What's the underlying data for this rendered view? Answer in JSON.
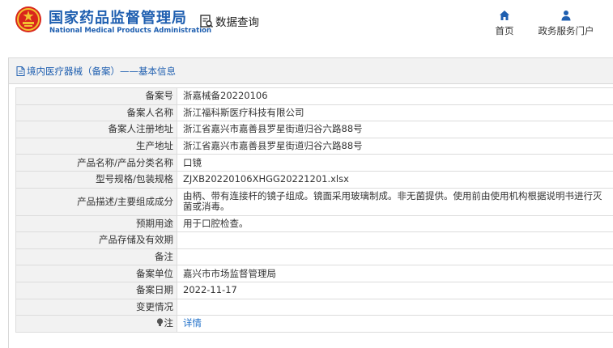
{
  "header": {
    "brand_cn": "国家药品监督管理局",
    "brand_en": "National Medical Products Administration",
    "query_label": "数据查询",
    "nav": {
      "home": "首页",
      "portal": "政务服务门户"
    }
  },
  "panel": {
    "title": "境内医疗器械（备案）——基本信息"
  },
  "rows": [
    {
      "key": "备案号",
      "value": "浙嘉械备20220106"
    },
    {
      "key": "备案人名称",
      "value": "浙江福科斯医疗科技有限公司"
    },
    {
      "key": "备案人注册地址",
      "value": "浙江省嘉兴市嘉善县罗星街道归谷六路88号"
    },
    {
      "key": "生产地址",
      "value": "浙江省嘉兴市嘉善县罗星街道归谷六路88号"
    },
    {
      "key": "产品名称/产品分类名称",
      "value": "口镜"
    },
    {
      "key": "型号规格/包装规格",
      "value": "ZJXB20220106XHGG20221201.xlsx"
    },
    {
      "key": "产品描述/主要组成成分",
      "value": "由柄、带有连接杆的镜子组成。镜面采用玻璃制成。非无菌提供。使用前由使用机构根据说明书进行灭菌或消毒。"
    },
    {
      "key": "预期用途",
      "value": "用于口腔检查。"
    },
    {
      "key": "产品存储及有效期",
      "value": ""
    },
    {
      "key": "备注",
      "value": ""
    },
    {
      "key": "备案单位",
      "value": "嘉兴市市场监督管理局"
    },
    {
      "key": "备案日期",
      "value": "2022-11-17"
    },
    {
      "key": "变更情况",
      "value": ""
    },
    {
      "key": "注",
      "value": "详情"
    }
  ],
  "colors": {
    "brand_blue": "#1f5fb0",
    "emblem_red": "#d9261c",
    "emblem_gold": "#f2c230"
  },
  "icons": [
    "national-emblem-icon",
    "search-document-icon",
    "home-icon",
    "user-icon",
    "document-icon",
    "lightbulb-icon"
  ]
}
